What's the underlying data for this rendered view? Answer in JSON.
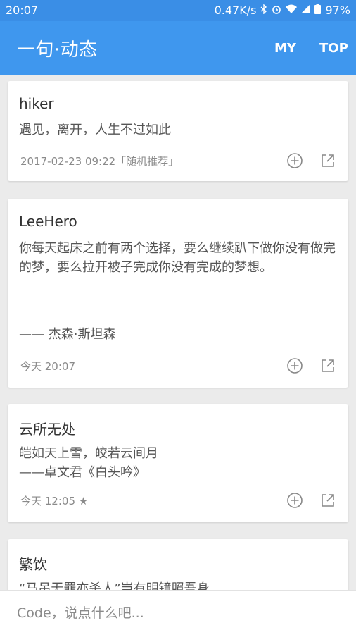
{
  "status_bar": {
    "time": "20:07",
    "network_speed": "0.47K/s",
    "battery": "97%",
    "icons": [
      "bluetooth-icon",
      "alarm-icon",
      "wifi-icon",
      "signal-icon",
      "battery-icon"
    ]
  },
  "app_bar": {
    "title": "一句·动态",
    "nav_my": "MY",
    "nav_top": "TOP"
  },
  "colors": {
    "primary": "#3f97ee",
    "status_bar": "#3a8ee6",
    "background": "#ebebeb"
  },
  "posts": [
    {
      "author": "hiker",
      "text": "遇见，离开，人生不过如此",
      "meta": "2017-02-23 09:22「随机推荐」"
    },
    {
      "author": "LeeHero",
      "text": "你每天起床之前有两个选择，要么继续趴下做你没有做完的梦，要么拉开被子完成你没有完成的梦想。",
      "attribution": "—— 杰森·斯坦森",
      "meta": "今天 20:07"
    },
    {
      "author": "云所无处",
      "text": "皑如天上雪，皎若云间月\n——卓文君《白头吟》",
      "meta": "今天 12:05 ★"
    },
    {
      "author": "繁饮",
      "text": "“马吊无罪亦杀人”岂有明镜照吾身"
    }
  ],
  "comment": {
    "placeholder": "Code，说点什么吧..."
  }
}
